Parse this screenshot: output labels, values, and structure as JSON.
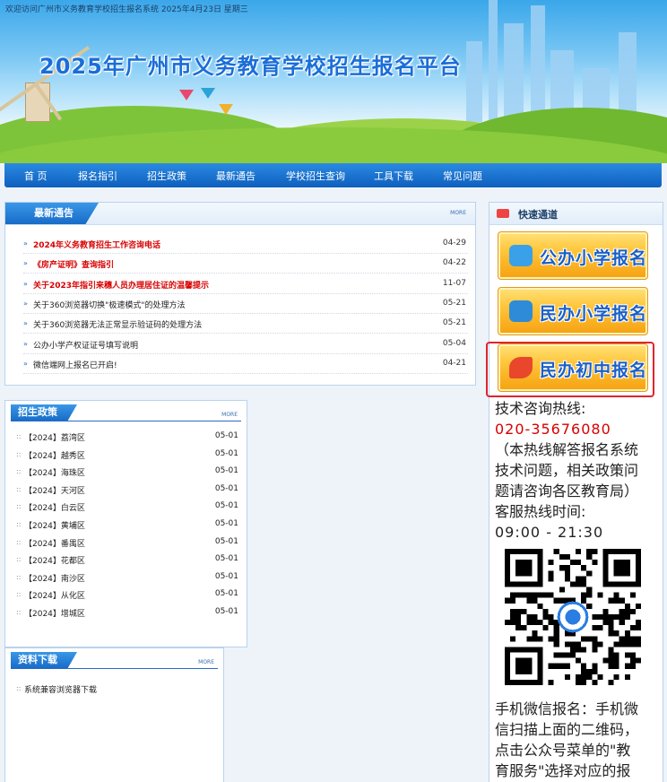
{
  "header": {
    "welcome": "欢迎访问广州市义务教育学校招生报名系统 2025年4月23日 星期三",
    "title": "2025年广州市义务教育学校招生报名平台"
  },
  "nav": {
    "items": [
      "首 页",
      "报名指引",
      "招生政策",
      "最新通告",
      "学校招生查询",
      "工具下载",
      "常见问题"
    ]
  },
  "notices": {
    "title": "最新通告",
    "more": "MORE",
    "items": [
      {
        "text": "2024年义务教育招生工作咨询电话",
        "date": "04-29",
        "highlight": true
      },
      {
        "text": "《房产证明》查询指引",
        "date": "04-22",
        "highlight": true
      },
      {
        "text": "关于2023年指引来穗人员办理居住证的温馨提示",
        "date": "11-07",
        "highlight": true
      },
      {
        "text": "关于360浏览器切换\"极速模式\"的处理方法",
        "date": "05-21",
        "highlight": false
      },
      {
        "text": "关于360浏览器无法正常显示验证码的处理方法",
        "date": "05-21",
        "highlight": false
      },
      {
        "text": "公办小学产权证证号填写说明",
        "date": "05-04",
        "highlight": false
      },
      {
        "text": "微信端网上报名已开启!",
        "date": "04-21",
        "highlight": false
      }
    ]
  },
  "policy": {
    "title": "招生政策",
    "more": "MORE",
    "items": [
      {
        "text": "【2024】荔湾区",
        "date": "05-01"
      },
      {
        "text": "【2024】越秀区",
        "date": "05-01"
      },
      {
        "text": "【2024】海珠区",
        "date": "05-01"
      },
      {
        "text": "【2024】天河区",
        "date": "05-01"
      },
      {
        "text": "【2024】白云区",
        "date": "05-01"
      },
      {
        "text": "【2024】黄埔区",
        "date": "05-01"
      },
      {
        "text": "【2024】番禺区",
        "date": "05-01"
      },
      {
        "text": "【2024】花都区",
        "date": "05-01"
      },
      {
        "text": "【2024】南沙区",
        "date": "05-01"
      },
      {
        "text": "【2024】从化区",
        "date": "05-01"
      },
      {
        "text": "【2024】增城区",
        "date": "05-01"
      }
    ]
  },
  "downloads": {
    "title": "资料下载",
    "more": "MORE",
    "items": [
      {
        "text": "系统兼容浏览器下载"
      }
    ]
  },
  "quick": {
    "title": "快速通道",
    "buttons": [
      {
        "label": "公办小学报名",
        "color": "#3aa0e8"
      },
      {
        "label": "民办小学报名",
        "color": "#2d8bd8"
      },
      {
        "label": "民办初中报名",
        "color": "#e8472c"
      }
    ],
    "hotline_label": "技术咨询热线:",
    "hotline_number": "020-35676080",
    "hotline_note": [
      "（本热线解答报名系统",
      "技术问题，相关政策问",
      "题请咨询各区教育局）"
    ],
    "service_label": "客服热线时间:",
    "service_time": "09:00 - 21:30",
    "wechat_text": [
      "手机微信报名：手机微",
      "信扫描上面的二维码，",
      "点击公众号菜单的\"教",
      "育服务\"选择对应的报"
    ]
  }
}
